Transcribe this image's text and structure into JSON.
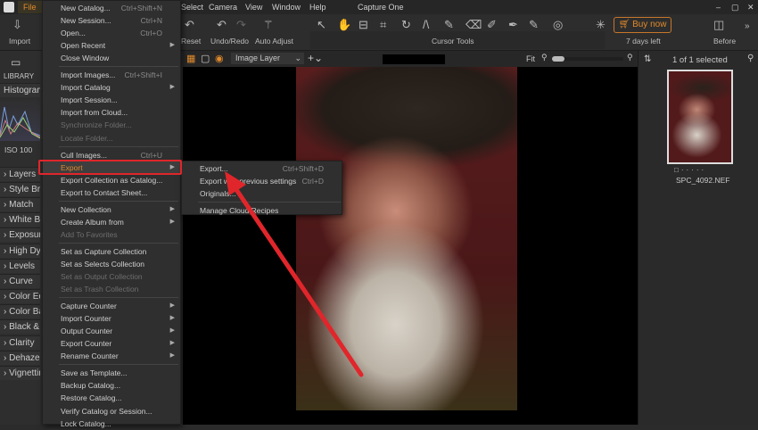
{
  "app": {
    "title": "Capture One",
    "file_menu": "File"
  },
  "menubar": [
    "Select",
    "Camera",
    "View",
    "Window",
    "Help"
  ],
  "toolbar": {
    "import": "Import",
    "reset": "Reset",
    "undo_redo": "Undo/Redo",
    "auto_adjust": "Auto Adjust",
    "cursor_tools": "Cursor Tools",
    "buy_now": "Buy now",
    "trial": "7 days left",
    "before": "Before"
  },
  "viewbar": {
    "layer": "Image Layer",
    "fit": "Fit"
  },
  "browser": {
    "count": "1 of 1 selected",
    "filename": "SPC_4092.NEF"
  },
  "left": {
    "library": "LIBRARY",
    "iso": "ISO 100",
    "tools": [
      "Histogram",
      "Layers",
      "Style Brushes",
      "Match",
      "White Balance",
      "Exposure",
      "High Dynamic Range",
      "Levels",
      "Curve",
      "Color Editor",
      "Color Balance",
      "Black & White",
      "Clarity",
      "Dehaze",
      "Vignetting"
    ]
  },
  "file_menu": [
    {
      "label": "New Catalog...",
      "shortcut": "Ctrl+Shift+N"
    },
    {
      "label": "New Session...",
      "shortcut": "Ctrl+N"
    },
    {
      "label": "Open...",
      "shortcut": "Ctrl+O"
    },
    {
      "label": "Open Recent",
      "submenu": true
    },
    {
      "label": "Close Window"
    },
    {
      "sep": true
    },
    {
      "label": "Import Images...",
      "shortcut": "Ctrl+Shift+I"
    },
    {
      "label": "Import Catalog",
      "submenu": true
    },
    {
      "label": "Import Session..."
    },
    {
      "label": "Import from Cloud..."
    },
    {
      "label": "Synchronize Folder...",
      "disabled": true
    },
    {
      "label": "Locate Folder...",
      "disabled": true
    },
    {
      "sep": true
    },
    {
      "label": "Cull Images...",
      "shortcut": "Ctrl+U"
    },
    {
      "label": "Export",
      "submenu": true,
      "highlighted": true
    },
    {
      "label": "Export Collection as Catalog..."
    },
    {
      "label": "Export to Contact Sheet..."
    },
    {
      "sep": true
    },
    {
      "label": "New Collection",
      "submenu": true
    },
    {
      "label": "Create Album from",
      "submenu": true
    },
    {
      "label": "Add To Favorites",
      "disabled": true
    },
    {
      "sep": true
    },
    {
      "label": "Set as Capture Collection"
    },
    {
      "label": "Set as Selects Collection"
    },
    {
      "label": "Set as Output Collection",
      "disabled": true
    },
    {
      "label": "Set as Trash Collection",
      "disabled": true
    },
    {
      "sep": true
    },
    {
      "label": "Capture Counter",
      "submenu": true
    },
    {
      "label": "Import Counter",
      "submenu": true
    },
    {
      "label": "Output Counter",
      "submenu": true
    },
    {
      "label": "Export Counter",
      "submenu": true
    },
    {
      "label": "Rename Counter",
      "submenu": true
    },
    {
      "sep": true
    },
    {
      "label": "Save as Template..."
    },
    {
      "label": "Backup Catalog..."
    },
    {
      "label": "Restore Catalog..."
    },
    {
      "label": "Verify Catalog or Session..."
    },
    {
      "label": "Lock Catalog..."
    }
  ],
  "export_submenu": [
    {
      "label": "Export...",
      "shortcut": "Ctrl+Shift+D"
    },
    {
      "label": "Export with previous settings",
      "shortcut": "Ctrl+D"
    },
    {
      "label": "Originals..."
    },
    {
      "sep": true
    },
    {
      "label": "Manage Cloud Recipes"
    }
  ],
  "colors": {
    "accent": "#e08a2c",
    "annotation": "#e0262b"
  }
}
